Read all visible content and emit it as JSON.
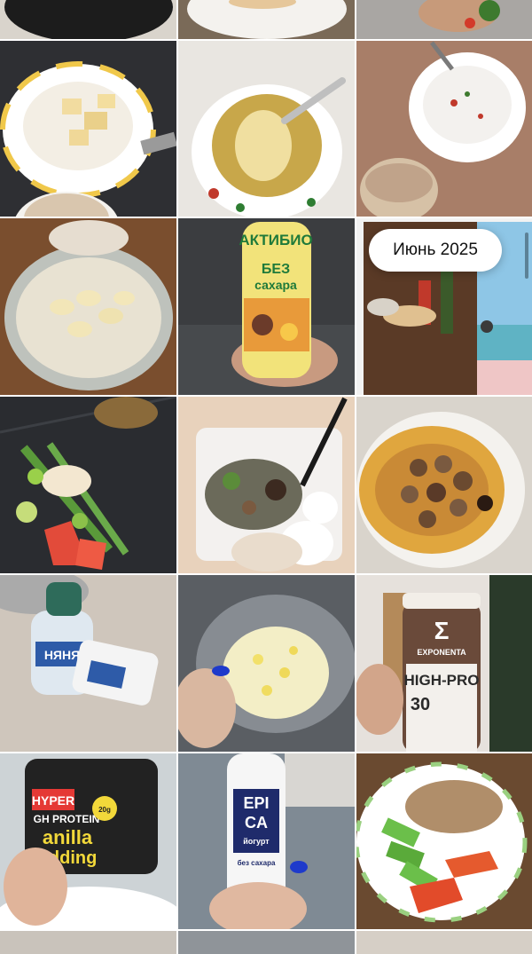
{
  "gallery": {
    "date_label": "Июнь 2025",
    "photos": [
      {
        "subject": "drink-glass"
      },
      {
        "subject": "plate-pancakes"
      },
      {
        "subject": "plate-salad"
      },
      {
        "subject": "cottage-cheese-bowl"
      },
      {
        "subject": "porridge-plate"
      },
      {
        "subject": "cottage-cheese-coffee"
      },
      {
        "subject": "banana-oats-bowl"
      },
      {
        "subject": "aktibio-drink-bottle"
      },
      {
        "subject": "table-with-drinks"
      },
      {
        "subject": "vegetables-board"
      },
      {
        "subject": "salad-container"
      },
      {
        "subject": "mushroom-omelette"
      },
      {
        "subject": "puree-pouch-and-yogurt"
      },
      {
        "subject": "egg-salad-bowl"
      },
      {
        "subject": "exponenta-high-pro-drink"
      },
      {
        "subject": "hyper-protein-pudding"
      },
      {
        "subject": "epica-yogurt-bottle"
      },
      {
        "subject": "chicken-vegetables-plate"
      }
    ]
  },
  "labels": {
    "aktibio_brand": "АКТИБИО",
    "aktibio_sub1": "БЕЗ",
    "aktibio_sub2": "сахара",
    "nyanya": "НЯНЯ",
    "exponenta_logo": "Σ",
    "exponenta_brand": "EXPONENTA",
    "exponenta_product": "HIGH-PRO",
    "exponenta_number": "30",
    "hyper_brand": "HYPER",
    "hyper_protein": "GH PROTEIN",
    "hyper_badge": "20g",
    "hyper_flavor1": "anilla",
    "hyper_flavor2": "udding",
    "epica_line1": "EPI",
    "epica_line2": "CA",
    "epica_type": "йогурт",
    "epica_sub": "без сахара"
  }
}
